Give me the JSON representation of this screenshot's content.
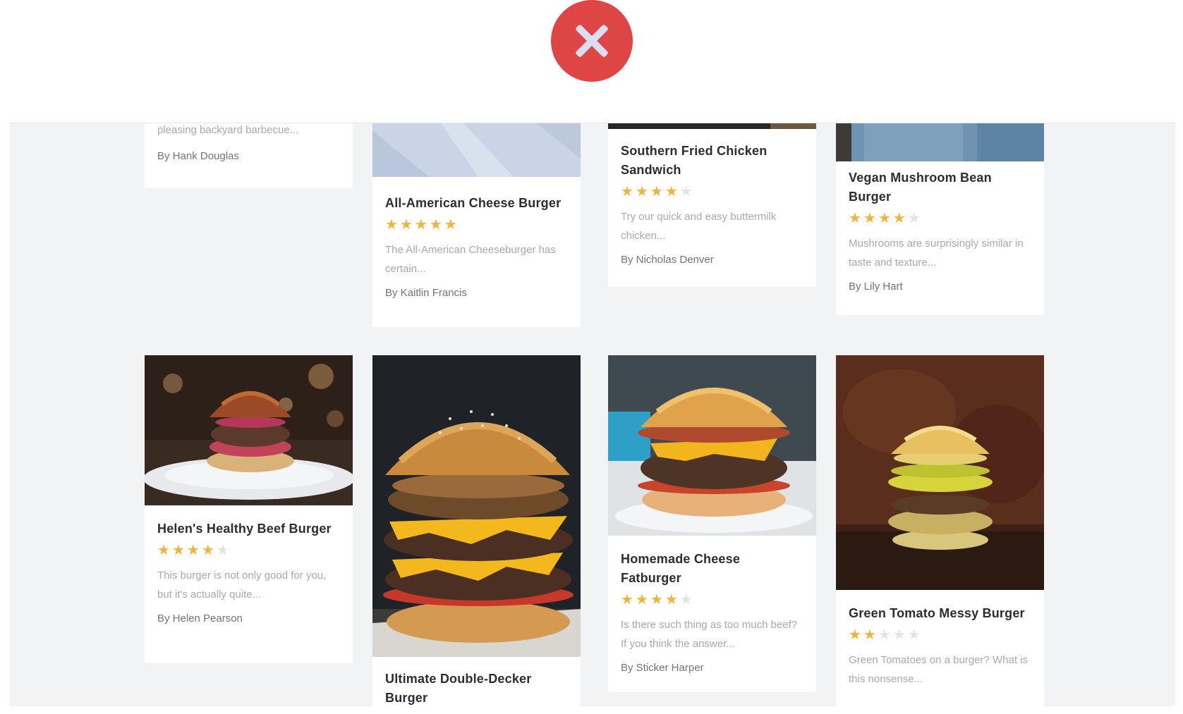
{
  "close_button": {
    "icon": "close-icon",
    "color": "#df4545"
  },
  "cards": [
    {
      "id": "c1",
      "title": "",
      "rating": 0,
      "description": "pleasing backyard barbecue...",
      "author": "By Hank Douglas"
    },
    {
      "id": "c2",
      "title": "All-American Cheese Burger",
      "rating": 5,
      "description": "The All-American Cheeseburger has certain...",
      "author": "By Kaitlin Francis"
    },
    {
      "id": "c3",
      "title": "Southern Fried Chicken Sandwich",
      "rating": 4,
      "description": "Try our quick and easy buttermilk chicken...",
      "author": "By Nicholas Denver"
    },
    {
      "id": "c4",
      "title": "Vegan Mushroom Bean Burger",
      "rating": 4,
      "description": "Mushrooms are surprisingly similar in taste and texture...",
      "author": "By Lily Hart"
    },
    {
      "id": "c5",
      "title": "Helen's Healthy Beef Burger",
      "rating": 4,
      "description": "This burger is not only good for you, but it's actually quite...",
      "author": "By Helen Pearson"
    },
    {
      "id": "c6",
      "title": "Ultimate Double-Decker Burger",
      "rating": 0,
      "description": "",
      "author": ""
    },
    {
      "id": "c7",
      "title": "Homemade Cheese Fatburger",
      "rating": 4,
      "description": "Is there such thing as too much beef? If you think the answer...",
      "author": "By Sticker Harper"
    },
    {
      "id": "c8",
      "title": "Green Tomato Messy Burger",
      "rating": 2,
      "description": "Green Tomatoes on a burger? What is this nonsense...",
      "author": ""
    }
  ],
  "colors": {
    "star_on": "#f0b43a",
    "star_off": "#e1e3e7",
    "panel_bg": "#f2f3f5"
  }
}
